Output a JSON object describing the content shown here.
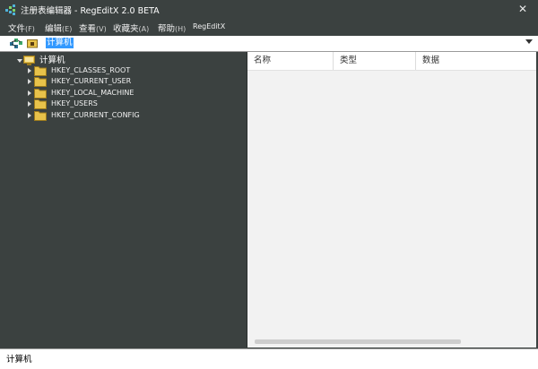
{
  "window": {
    "title": "注册表编辑器 - RegEditX 2.0 BETA",
    "close_glyph": "✕"
  },
  "menu": {
    "items": [
      {
        "label": "文件",
        "accel": "(F)"
      },
      {
        "label": "编辑",
        "accel": "(E)"
      },
      {
        "label": "查看",
        "accel": "(V)"
      },
      {
        "label": "收藏夹",
        "accel": "(A)"
      },
      {
        "label": "帮助",
        "accel": "(H)"
      },
      {
        "label": "RegEditX",
        "accel": ""
      }
    ]
  },
  "address": {
    "value": "计算机"
  },
  "tree": {
    "root": "计算机",
    "hives": [
      "HKEY_CLASSES_ROOT",
      "HKEY_CURRENT_USER",
      "HKEY_LOCAL_MACHINE",
      "HKEY_USERS",
      "HKEY_CURRENT_CONFIG"
    ]
  },
  "list": {
    "columns": [
      "名称",
      "类型",
      "数据"
    ]
  },
  "status": {
    "text": "计算机"
  },
  "colors": {
    "chrome": "#3b4140",
    "folder": "#e8c24a",
    "selection": "#3399ff"
  }
}
